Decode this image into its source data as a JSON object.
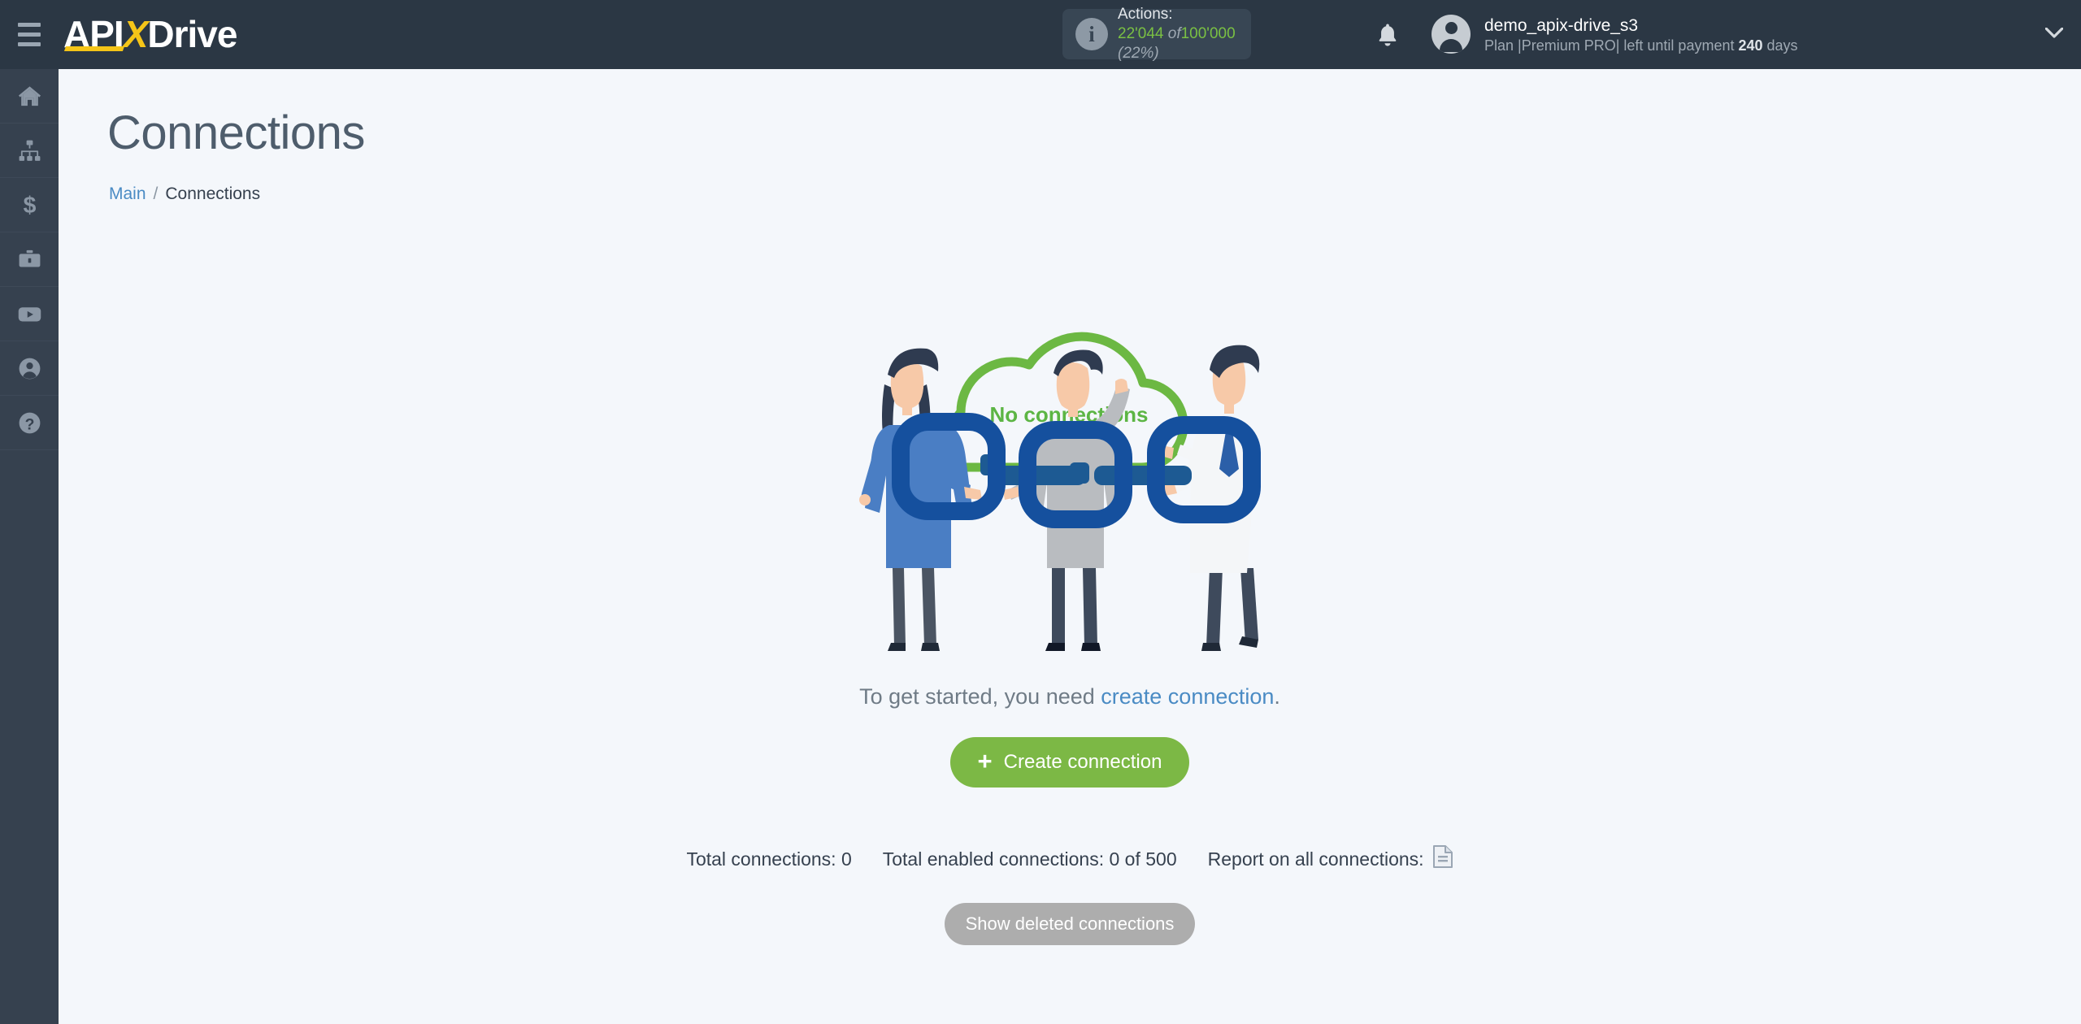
{
  "header": {
    "menu_icon": "hamburger-icon",
    "logo": {
      "part1": "API",
      "part2": "X",
      "part3": "Drive"
    },
    "actions": {
      "icon": "info-icon",
      "label": "Actions:",
      "used": "22'044",
      "of": "of",
      "total": "100'000",
      "percent": "(22%)"
    },
    "notifications_icon": "bell-icon",
    "user": {
      "avatar_icon": "user-avatar-icon",
      "name": "demo_apix-drive_s3",
      "plan_prefix": "Plan |",
      "plan_name": "Premium PRO",
      "plan_mid": "| left until payment ",
      "days": "240",
      "plan_suffix": " days"
    },
    "dropdown_icon": "chevron-down-icon"
  },
  "sidebar": {
    "items": [
      {
        "icon": "home-icon",
        "name": "sidebar-item-home"
      },
      {
        "icon": "sitemap-icon",
        "name": "sidebar-item-connections"
      },
      {
        "icon": "dollar-icon",
        "name": "sidebar-item-billing"
      },
      {
        "icon": "briefcase-icon",
        "name": "sidebar-item-business"
      },
      {
        "icon": "youtube-icon",
        "name": "sidebar-item-youtube"
      },
      {
        "icon": "account-icon",
        "name": "sidebar-item-account"
      },
      {
        "icon": "question-icon",
        "name": "sidebar-item-help"
      }
    ]
  },
  "page": {
    "title": "Connections",
    "breadcrumb": {
      "root": "Main",
      "separator": "/",
      "current": "Connections"
    },
    "empty_state": {
      "cloud_label": "No connections",
      "hint_before": "To get started, you need ",
      "hint_link": "create connection",
      "hint_after": "."
    },
    "create_button": {
      "plus": "+",
      "label": "Create connection"
    },
    "stats": {
      "total": "Total connections: 0",
      "enabled": "Total enabled connections: 0 of 500",
      "report_label": "Report on all connections:",
      "report_icon": "document-report-icon"
    },
    "deleted_button": "Show deleted connections"
  },
  "colors": {
    "header_bg": "#2b3744",
    "sidebar_bg": "#36414f",
    "page_bg": "#f4f7fb",
    "accent_green": "#7cb845",
    "cloud_green": "#5cb544",
    "link_blue": "#4a8bc4",
    "logo_yellow": "#f5c518",
    "gray_button": "#adadad",
    "chain_blue": "#15509e"
  }
}
